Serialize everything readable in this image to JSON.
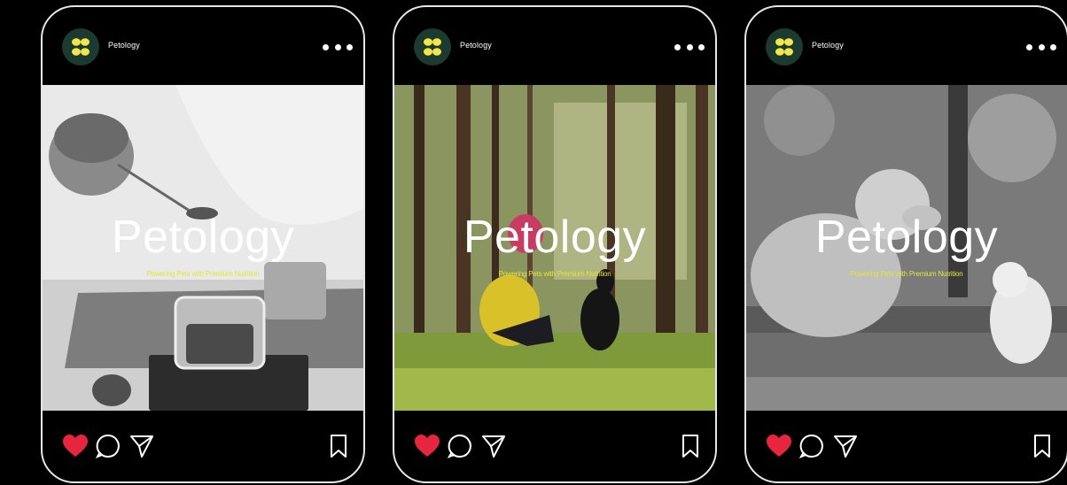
{
  "posts": [
    {
      "account_name": "Petology",
      "title": "Petology",
      "tagline": "Powering Pets with Premium Nutrition",
      "image": "gloved-hand-scooping-pet-food"
    },
    {
      "account_name": "Petology",
      "title": "Petology",
      "tagline": "Powering Pets with Premium Nutrition",
      "image": "woman-with-black-dog-in-forest"
    },
    {
      "account_name": "Petology",
      "title": "Petology",
      "tagline": "Powering Pets with Premium Nutrition",
      "image": "golden-retriever-and-kitten-on-grass"
    }
  ],
  "icons": {
    "avatar": "petology-logo-icon",
    "more": "more-options-icon",
    "like": "heart-icon",
    "comment": "comment-icon",
    "share": "send-icon",
    "save": "bookmark-icon"
  },
  "colors": {
    "background": "#000000",
    "frame": "#e6e6e6",
    "like": "#e8253f",
    "tagline": "#e8e33a",
    "logo_bg": "#1c3a2f",
    "logo_fg": "#f2e64a"
  }
}
